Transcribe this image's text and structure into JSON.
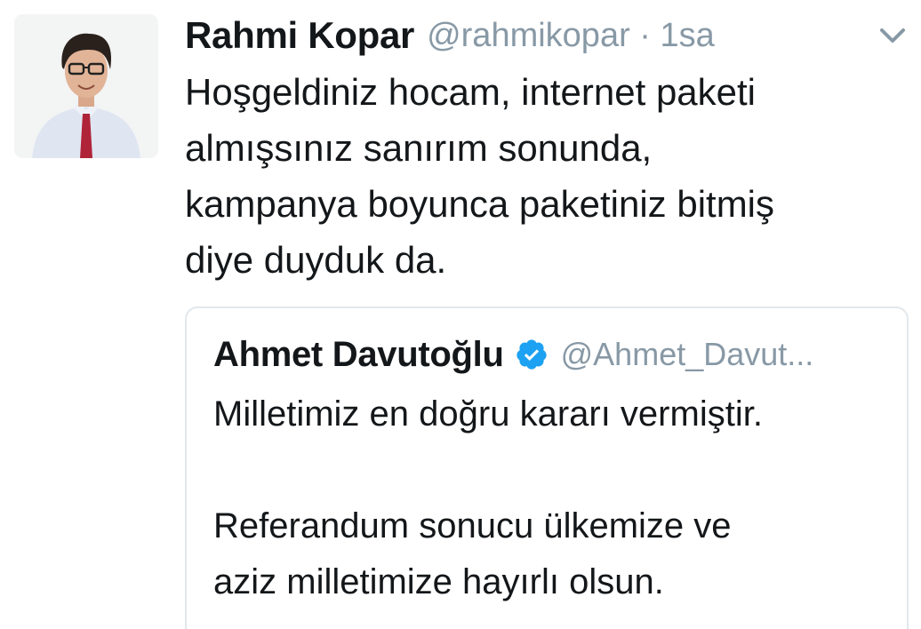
{
  "tweet": {
    "author": {
      "display_name": "Rahmi Kopar",
      "handle_meta": "@rahmikopar · 1sa",
      "avatar_icon": "profile-photo"
    },
    "menu_icon": "chevron-down-icon",
    "text_lines": [
      "Hoşgeldiniz hocam, internet paketi",
      "almışsınız sanırım sonunda,",
      "kampanya boyunca paketiniz bitmiş",
      "diye duyduk da."
    ]
  },
  "quoted_tweet": {
    "display_name": "Ahmet Davutoğlu",
    "verified_icon": "verified-badge-icon",
    "handle": "@Ahmet_Davut...",
    "text_lines": [
      "Milletimiz en doğru kararı vermiştir.",
      "",
      "Referandum sonucu ülkemize ve",
      "aziz milletimize hayırlı olsun."
    ]
  },
  "colors": {
    "text_primary": "#14171a",
    "text_secondary": "#8899a6",
    "card_border": "#e1e8ed",
    "verified_blue": "#1da1f2"
  }
}
